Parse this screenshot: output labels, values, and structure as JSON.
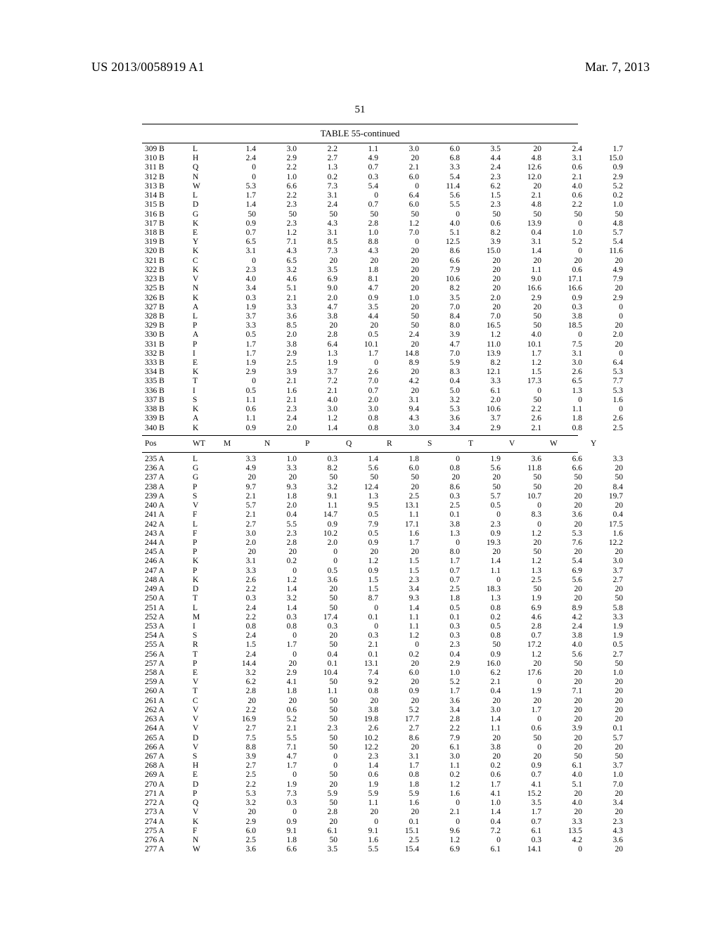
{
  "header": {
    "pub_number": "US 2013/0058919 A1",
    "date": "Mar. 7, 2013",
    "page_number": "51"
  },
  "table": {
    "title": "TABLE 55-continued",
    "header_row": {
      "pos": "Pos",
      "wt": "WT",
      "cols": [
        "M",
        "N",
        "P",
        "Q",
        "R",
        "S",
        "T",
        "V",
        "W",
        "Y"
      ]
    },
    "block1": [
      {
        "pos": "309 B",
        "wt": "L",
        "v": [
          "1.4",
          "3.0",
          "2.2",
          "1.1",
          "3.0",
          "6.0",
          "3.5",
          "20",
          "2.4",
          "1.7"
        ]
      },
      {
        "pos": "310 B",
        "wt": "H",
        "v": [
          "2.4",
          "2.9",
          "2.7",
          "4.9",
          "20",
          "6.8",
          "4.4",
          "4.8",
          "3.1",
          "15.0"
        ]
      },
      {
        "pos": "311 B",
        "wt": "Q",
        "v": [
          "0",
          "2.2",
          "1.3",
          "0.7",
          "2.1",
          "3.3",
          "2.4",
          "12.6",
          "0.6",
          "0.9"
        ]
      },
      {
        "pos": "312 B",
        "wt": "N",
        "v": [
          "0",
          "1.0",
          "0.2",
          "0.3",
          "6.0",
          "5.4",
          "2.3",
          "12.0",
          "2.1",
          "2.9"
        ]
      },
      {
        "pos": "313 B",
        "wt": "W",
        "v": [
          "5.3",
          "6.6",
          "7.3",
          "5.4",
          "0",
          "11.4",
          "6.2",
          "20",
          "4.0",
          "5.2"
        ]
      },
      {
        "pos": "314 B",
        "wt": "L",
        "v": [
          "1.7",
          "2.2",
          "3.1",
          "0",
          "6.4",
          "5.6",
          "1.5",
          "2.1",
          "0.6",
          "0.2"
        ]
      },
      {
        "pos": "315 B",
        "wt": "D",
        "v": [
          "1.4",
          "2.3",
          "2.4",
          "0.7",
          "6.0",
          "5.5",
          "2.3",
          "4.8",
          "2.2",
          "1.0"
        ]
      },
      {
        "pos": "316 B",
        "wt": "G",
        "v": [
          "50",
          "50",
          "50",
          "50",
          "50",
          "0",
          "50",
          "50",
          "50",
          "50"
        ]
      },
      {
        "pos": "317 B",
        "wt": "K",
        "v": [
          "0.9",
          "2.3",
          "4.3",
          "2.8",
          "1.2",
          "4.0",
          "0.6",
          "13.9",
          "0",
          "4.8"
        ]
      },
      {
        "pos": "318 B",
        "wt": "E",
        "v": [
          "0.7",
          "1.2",
          "3.1",
          "1.0",
          "7.0",
          "5.1",
          "8.2",
          "0.4",
          "1.0",
          "5.7"
        ]
      },
      {
        "pos": "319 B",
        "wt": "Y",
        "v": [
          "6.5",
          "7.1",
          "8.5",
          "8.8",
          "0",
          "12.5",
          "3.9",
          "3.1",
          "5.2",
          "5.4"
        ]
      },
      {
        "pos": "320 B",
        "wt": "K",
        "v": [
          "3.1",
          "4.3",
          "7.3",
          "4.3",
          "20",
          "8.6",
          "15.0",
          "1.4",
          "0",
          "11.6"
        ]
      },
      {
        "pos": "321 B",
        "wt": "C",
        "v": [
          "0",
          "6.5",
          "20",
          "20",
          "20",
          "6.6",
          "20",
          "20",
          "20",
          "20"
        ]
      },
      {
        "pos": "322 B",
        "wt": "K",
        "v": [
          "2.3",
          "3.2",
          "3.5",
          "1.8",
          "20",
          "7.9",
          "20",
          "1.1",
          "0.6",
          "4.9"
        ]
      },
      {
        "pos": "323 B",
        "wt": "V",
        "v": [
          "4.0",
          "4.6",
          "6.9",
          "8.1",
          "20",
          "10.6",
          "20",
          "9.0",
          "17.1",
          "7.9"
        ]
      },
      {
        "pos": "325 B",
        "wt": "N",
        "v": [
          "3.4",
          "5.1",
          "9.0",
          "4.7",
          "20",
          "8.2",
          "20",
          "16.6",
          "16.6",
          "20"
        ]
      },
      {
        "pos": "326 B",
        "wt": "K",
        "v": [
          "0.3",
          "2.1",
          "2.0",
          "0.9",
          "1.0",
          "3.5",
          "2.0",
          "2.9",
          "0.9",
          "2.9"
        ]
      },
      {
        "pos": "327 B",
        "wt": "A",
        "v": [
          "1.9",
          "3.3",
          "4.7",
          "3.5",
          "20",
          "7.0",
          "20",
          "20",
          "0.3",
          "0"
        ]
      },
      {
        "pos": "328 B",
        "wt": "L",
        "v": [
          "3.7",
          "3.6",
          "3.8",
          "4.4",
          "50",
          "8.4",
          "7.0",
          "50",
          "3.8",
          "0"
        ]
      },
      {
        "pos": "329 B",
        "wt": "P",
        "v": [
          "3.3",
          "8.5",
          "20",
          "20",
          "50",
          "8.0",
          "16.5",
          "50",
          "18.5",
          "20"
        ]
      },
      {
        "pos": "330 B",
        "wt": "A",
        "v": [
          "0.5",
          "2.0",
          "2.8",
          "0.5",
          "2.4",
          "3.9",
          "1.2",
          "4.0",
          "0",
          "2.0"
        ]
      },
      {
        "pos": "331 B",
        "wt": "P",
        "v": [
          "1.7",
          "3.8",
          "6.4",
          "10.1",
          "20",
          "4.7",
          "11.0",
          "10.1",
          "7.5",
          "20"
        ]
      },
      {
        "pos": "332 B",
        "wt": "I",
        "v": [
          "1.7",
          "2.9",
          "1.3",
          "1.7",
          "14.8",
          "7.0",
          "13.9",
          "1.7",
          "3.1",
          "0"
        ]
      },
      {
        "pos": "333 B",
        "wt": "E",
        "v": [
          "1.9",
          "2.5",
          "1.9",
          "0",
          "8.9",
          "5.9",
          "8.2",
          "1.2",
          "3.0",
          "6.4"
        ]
      },
      {
        "pos": "334 B",
        "wt": "K",
        "v": [
          "2.9",
          "3.9",
          "3.7",
          "2.6",
          "20",
          "8.3",
          "12.1",
          "1.5",
          "2.6",
          "5.3"
        ]
      },
      {
        "pos": "335 B",
        "wt": "T",
        "v": [
          "0",
          "2.1",
          "7.2",
          "7.0",
          "4.2",
          "0.4",
          "3.3",
          "17.3",
          "6.5",
          "7.7"
        ]
      },
      {
        "pos": "336 B",
        "wt": "I",
        "v": [
          "0.5",
          "1.6",
          "2.1",
          "0.7",
          "20",
          "5.0",
          "6.1",
          "0",
          "1.3",
          "5.3"
        ]
      },
      {
        "pos": "337 B",
        "wt": "S",
        "v": [
          "1.1",
          "2.1",
          "4.0",
          "2.0",
          "3.1",
          "3.2",
          "2.0",
          "50",
          "0",
          "1.6"
        ]
      },
      {
        "pos": "338 B",
        "wt": "K",
        "v": [
          "0.6",
          "2.3",
          "3.0",
          "3.0",
          "9.4",
          "5.3",
          "10.6",
          "2.2",
          "1.1",
          "0"
        ]
      },
      {
        "pos": "339 B",
        "wt": "A",
        "v": [
          "1.1",
          "2.4",
          "1.2",
          "0.8",
          "4.3",
          "3.6",
          "3.7",
          "2.6",
          "1.8",
          "2.6"
        ]
      },
      {
        "pos": "340 B",
        "wt": "K",
        "v": [
          "0.9",
          "2.0",
          "1.4",
          "0.8",
          "3.0",
          "3.4",
          "2.9",
          "2.1",
          "0.8",
          "2.5"
        ]
      }
    ],
    "block2": [
      {
        "pos": "235 A",
        "wt": "L",
        "v": [
          "3.3",
          "1.0",
          "0.3",
          "1.4",
          "1.8",
          "0",
          "1.9",
          "3.6",
          "6.6",
          "3.3"
        ]
      },
      {
        "pos": "236 A",
        "wt": "G",
        "v": [
          "4.9",
          "3.3",
          "8.2",
          "5.6",
          "6.0",
          "0.8",
          "5.6",
          "11.8",
          "6.6",
          "20"
        ]
      },
      {
        "pos": "237 A",
        "wt": "G",
        "v": [
          "20",
          "20",
          "50",
          "50",
          "50",
          "20",
          "20",
          "50",
          "50",
          "50"
        ]
      },
      {
        "pos": "238 A",
        "wt": "P",
        "v": [
          "9.7",
          "9.3",
          "3.2",
          "12.4",
          "20",
          "8.6",
          "50",
          "50",
          "20",
          "8.4"
        ]
      },
      {
        "pos": "239 A",
        "wt": "S",
        "v": [
          "2.1",
          "1.8",
          "9.1",
          "1.3",
          "2.5",
          "0.3",
          "5.7",
          "10.7",
          "20",
          "19.7"
        ]
      },
      {
        "pos": "240 A",
        "wt": "V",
        "v": [
          "5.7",
          "2.0",
          "1.1",
          "9.5",
          "13.1",
          "2.5",
          "0.5",
          "0",
          "20",
          "20"
        ]
      },
      {
        "pos": "241 A",
        "wt": "F",
        "v": [
          "2.1",
          "0.4",
          "14.7",
          "0.5",
          "1.1",
          "0.1",
          "0",
          "8.3",
          "3.6",
          "0.4"
        ]
      },
      {
        "pos": "242 A",
        "wt": "L",
        "v": [
          "2.7",
          "5.5",
          "0.9",
          "7.9",
          "17.1",
          "3.8",
          "2.3",
          "0",
          "20",
          "17.5"
        ]
      },
      {
        "pos": "243 A",
        "wt": "F",
        "v": [
          "3.0",
          "2.3",
          "10.2",
          "0.5",
          "1.6",
          "1.3",
          "0.9",
          "1.2",
          "5.3",
          "1.6"
        ]
      },
      {
        "pos": "244 A",
        "wt": "P",
        "v": [
          "2.0",
          "2.8",
          "2.0",
          "0.9",
          "1.7",
          "0",
          "19.3",
          "20",
          "7.6",
          "12.2"
        ]
      },
      {
        "pos": "245 A",
        "wt": "P",
        "v": [
          "20",
          "20",
          "0",
          "20",
          "20",
          "8.0",
          "20",
          "50",
          "20",
          "20"
        ]
      },
      {
        "pos": "246 A",
        "wt": "K",
        "v": [
          "3.1",
          "0.2",
          "0",
          "1.2",
          "1.5",
          "1.7",
          "1.4",
          "1.2",
          "5.4",
          "3.0"
        ]
      },
      {
        "pos": "247 A",
        "wt": "P",
        "v": [
          "3.3",
          "0",
          "0.5",
          "0.9",
          "1.5",
          "0.7",
          "1.1",
          "1.3",
          "6.9",
          "3.7"
        ]
      },
      {
        "pos": "248 A",
        "wt": "K",
        "v": [
          "2.6",
          "1.2",
          "3.6",
          "1.5",
          "2.3",
          "0.7",
          "0",
          "2.5",
          "5.6",
          "2.7"
        ]
      },
      {
        "pos": "249 A",
        "wt": "D",
        "v": [
          "2.2",
          "1.4",
          "20",
          "1.5",
          "3.4",
          "2.5",
          "18.3",
          "50",
          "20",
          "20"
        ]
      },
      {
        "pos": "250 A",
        "wt": "T",
        "v": [
          "0.3",
          "3.2",
          "50",
          "8.7",
          "9.3",
          "1.8",
          "1.3",
          "1.9",
          "20",
          "50"
        ]
      },
      {
        "pos": "251 A",
        "wt": "L",
        "v": [
          "2.4",
          "1.4",
          "50",
          "0",
          "1.4",
          "0.5",
          "0.8",
          "6.9",
          "8.9",
          "5.8"
        ]
      },
      {
        "pos": "252 A",
        "wt": "M",
        "v": [
          "2.2",
          "0.3",
          "17.4",
          "0.1",
          "1.1",
          "0.1",
          "0.2",
          "4.6",
          "4.2",
          "3.3"
        ]
      },
      {
        "pos": "253 A",
        "wt": "I",
        "v": [
          "0.8",
          "0.8",
          "0.3",
          "0",
          "1.1",
          "0.3",
          "0.5",
          "2.8",
          "2.4",
          "1.9"
        ]
      },
      {
        "pos": "254 A",
        "wt": "S",
        "v": [
          "2.4",
          "0",
          "20",
          "0.3",
          "1.2",
          "0.3",
          "0.8",
          "0.7",
          "3.8",
          "1.9"
        ]
      },
      {
        "pos": "255 A",
        "wt": "R",
        "v": [
          "1.5",
          "1.7",
          "50",
          "2.1",
          "0",
          "2.3",
          "50",
          "17.2",
          "4.0",
          "0.5"
        ]
      },
      {
        "pos": "256 A",
        "wt": "T",
        "v": [
          "2.4",
          "0",
          "0.4",
          "0.1",
          "0.2",
          "0.4",
          "0.9",
          "1.2",
          "5.6",
          "2.7"
        ]
      },
      {
        "pos": "257 A",
        "wt": "P",
        "v": [
          "14.4",
          "20",
          "0.1",
          "13.1",
          "20",
          "2.9",
          "16.0",
          "20",
          "50",
          "50"
        ]
      },
      {
        "pos": "258 A",
        "wt": "E",
        "v": [
          "3.2",
          "2.9",
          "10.4",
          "7.4",
          "6.0",
          "1.0",
          "6.2",
          "17.6",
          "20",
          "1.0"
        ]
      },
      {
        "pos": "259 A",
        "wt": "V",
        "v": [
          "6.2",
          "4.1",
          "50",
          "9.2",
          "20",
          "5.2",
          "2.1",
          "0",
          "20",
          "20"
        ]
      },
      {
        "pos": "260 A",
        "wt": "T",
        "v": [
          "2.8",
          "1.8",
          "1.1",
          "0.8",
          "0.9",
          "1.7",
          "0.4",
          "1.9",
          "7.1",
          "20"
        ]
      },
      {
        "pos": "261 A",
        "wt": "C",
        "v": [
          "20",
          "20",
          "50",
          "20",
          "20",
          "3.6",
          "20",
          "20",
          "20",
          "20"
        ]
      },
      {
        "pos": "262 A",
        "wt": "V",
        "v": [
          "2.2",
          "0.6",
          "50",
          "3.8",
          "5.2",
          "3.4",
          "3.0",
          "1.7",
          "20",
          "20"
        ]
      },
      {
        "pos": "263 A",
        "wt": "V",
        "v": [
          "16.9",
          "5.2",
          "50",
          "19.8",
          "17.7",
          "2.8",
          "1.4",
          "0",
          "20",
          "20"
        ]
      },
      {
        "pos": "264 A",
        "wt": "V",
        "v": [
          "2.7",
          "2.1",
          "2.3",
          "2.6",
          "2.7",
          "2.2",
          "1.1",
          "0.6",
          "3.9",
          "0.1"
        ]
      },
      {
        "pos": "265 A",
        "wt": "D",
        "v": [
          "7.5",
          "5.5",
          "50",
          "10.2",
          "8.6",
          "7.9",
          "20",
          "50",
          "20",
          "5.7"
        ]
      },
      {
        "pos": "266 A",
        "wt": "V",
        "v": [
          "8.8",
          "7.1",
          "50",
          "12.2",
          "20",
          "6.1",
          "3.8",
          "0",
          "20",
          "20"
        ]
      },
      {
        "pos": "267 A",
        "wt": "S",
        "v": [
          "3.9",
          "4.7",
          "0",
          "2.3",
          "3.1",
          "3.0",
          "20",
          "20",
          "50",
          "50"
        ]
      },
      {
        "pos": "268 A",
        "wt": "H",
        "v": [
          "2.7",
          "1.7",
          "0",
          "1.4",
          "1.7",
          "1.1",
          "0.2",
          "0.9",
          "6.1",
          "3.7"
        ]
      },
      {
        "pos": "269 A",
        "wt": "E",
        "v": [
          "2.5",
          "0",
          "50",
          "0.6",
          "0.8",
          "0.2",
          "0.6",
          "0.7",
          "4.0",
          "1.0"
        ]
      },
      {
        "pos": "270 A",
        "wt": "D",
        "v": [
          "2.2",
          "1.9",
          "20",
          "1.9",
          "1.8",
          "1.2",
          "1.7",
          "4.1",
          "5.1",
          "7.0"
        ]
      },
      {
        "pos": "271 A",
        "wt": "P",
        "v": [
          "5.3",
          "7.3",
          "5.9",
          "5.9",
          "5.9",
          "1.6",
          "4.1",
          "15.2",
          "20",
          "20"
        ]
      },
      {
        "pos": "272 A",
        "wt": "Q",
        "v": [
          "3.2",
          "0.3",
          "50",
          "1.1",
          "1.6",
          "0",
          "1.0",
          "3.5",
          "4.0",
          "3.4"
        ]
      },
      {
        "pos": "273 A",
        "wt": "V",
        "v": [
          "20",
          "0",
          "2.8",
          "20",
          "20",
          "2.1",
          "1.4",
          "1.7",
          "20",
          "20"
        ]
      },
      {
        "pos": "274 A",
        "wt": "K",
        "v": [
          "2.9",
          "0.9",
          "20",
          "0",
          "0.1",
          "0",
          "0.4",
          "0.7",
          "3.3",
          "2.3"
        ]
      },
      {
        "pos": "275 A",
        "wt": "F",
        "v": [
          "6.0",
          "9.1",
          "6.1",
          "9.1",
          "15.1",
          "9.6",
          "7.2",
          "6.1",
          "13.5",
          "4.3"
        ]
      },
      {
        "pos": "276 A",
        "wt": "N",
        "v": [
          "2.5",
          "1.8",
          "50",
          "1.6",
          "2.5",
          "1.2",
          "0",
          "0.3",
          "4.2",
          "3.6"
        ]
      },
      {
        "pos": "277 A",
        "wt": "W",
        "v": [
          "3.6",
          "6.6",
          "3.5",
          "5.5",
          "15.4",
          "6.9",
          "6.1",
          "14.1",
          "0",
          "20"
        ]
      }
    ]
  },
  "chart_data": {
    "type": "table",
    "title": "TABLE 55-continued",
    "columns": [
      "Pos",
      "WT",
      "M",
      "N",
      "P",
      "Q",
      "R",
      "S",
      "T",
      "V",
      "W",
      "Y"
    ],
    "note": "Rows are listed under table.block1 and table.block2."
  }
}
